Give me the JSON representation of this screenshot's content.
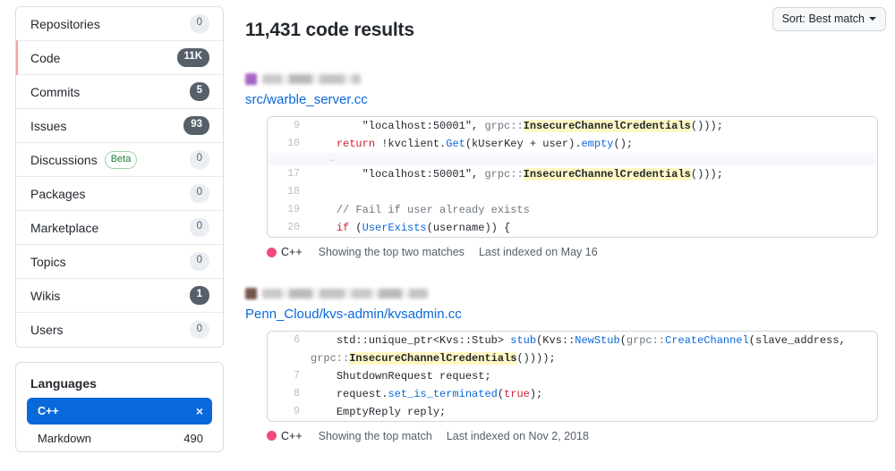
{
  "sidebar": {
    "nav_items": [
      {
        "label": "Repositories",
        "count": "0",
        "zero": true,
        "active": false,
        "badge": null
      },
      {
        "label": "Code",
        "count": "11K",
        "zero": false,
        "active": true,
        "badge": null
      },
      {
        "label": "Commits",
        "count": "5",
        "zero": false,
        "active": false,
        "badge": null
      },
      {
        "label": "Issues",
        "count": "93",
        "zero": false,
        "active": false,
        "badge": null
      },
      {
        "label": "Discussions",
        "count": "0",
        "zero": true,
        "active": false,
        "badge": "Beta"
      },
      {
        "label": "Packages",
        "count": "0",
        "zero": true,
        "active": false,
        "badge": null
      },
      {
        "label": "Marketplace",
        "count": "0",
        "zero": true,
        "active": false,
        "badge": null
      },
      {
        "label": "Topics",
        "count": "0",
        "zero": true,
        "active": false,
        "badge": null
      },
      {
        "label": "Wikis",
        "count": "1",
        "zero": false,
        "active": false,
        "badge": null
      },
      {
        "label": "Users",
        "count": "0",
        "zero": true,
        "active": false,
        "badge": null
      }
    ],
    "languages": {
      "title": "Languages",
      "selected": {
        "name": "C++",
        "remove_icon": "close-icon",
        "remove_glyph": "×"
      },
      "items": [
        {
          "name": "Markdown",
          "count": "490"
        }
      ]
    }
  },
  "header": {
    "title": "11,431 code results",
    "sort": {
      "label": "Sort: Best match",
      "icon": "chevron-down-icon"
    }
  },
  "results": [
    {
      "avatar_color": "purple",
      "repo_blur_width": 110,
      "file_path": "src/warble_server.cc",
      "lines": [
        {
          "num": "9",
          "type": "code",
          "tokens": [
            {
              "t": "        ",
              "c": "t-plain"
            },
            {
              "t": "\"localhost:50001\"",
              "c": "t-str"
            },
            {
              "t": ", ",
              "c": "t-plain"
            },
            {
              "t": "grpc::",
              "c": "t-ns"
            },
            {
              "t": "InsecureChannelCredentials",
              "c": "hl"
            },
            {
              "t": "()));",
              "c": "t-plain"
            }
          ]
        },
        {
          "num": "10",
          "type": "code",
          "tokens": [
            {
              "t": "    ",
              "c": "t-plain"
            },
            {
              "t": "return",
              "c": "t-kw"
            },
            {
              "t": " !kvclient.",
              "c": "t-plain"
            },
            {
              "t": "Get",
              "c": "t-fn"
            },
            {
              "t": "(kUserKey + user).",
              "c": "t-plain"
            },
            {
              "t": "empty",
              "c": "t-fn"
            },
            {
              "t": "();",
              "c": "t-plain"
            }
          ]
        },
        {
          "num": "",
          "type": "sep",
          "dots": "…"
        },
        {
          "num": "17",
          "type": "code",
          "tokens": [
            {
              "t": "        ",
              "c": "t-plain"
            },
            {
              "t": "\"localhost:50001\"",
              "c": "t-str"
            },
            {
              "t": ", ",
              "c": "t-plain"
            },
            {
              "t": "grpc::",
              "c": "t-ns"
            },
            {
              "t": "InsecureChannelCredentials",
              "c": "hl"
            },
            {
              "t": "()));",
              "c": "t-plain"
            }
          ]
        },
        {
          "num": "18",
          "type": "code",
          "tokens": [
            {
              "t": "",
              "c": "t-plain"
            }
          ]
        },
        {
          "num": "19",
          "type": "code",
          "tokens": [
            {
              "t": "    ",
              "c": "t-plain"
            },
            {
              "t": "// Fail if user already exists",
              "c": "t-cmt"
            }
          ]
        },
        {
          "num": "20",
          "type": "code",
          "tokens": [
            {
              "t": "    ",
              "c": "t-plain"
            },
            {
              "t": "if",
              "c": "t-kw"
            },
            {
              "t": " (",
              "c": "t-plain"
            },
            {
              "t": "UserExists",
              "c": "t-fn"
            },
            {
              "t": "(username)) {",
              "c": "t-plain"
            }
          ]
        }
      ],
      "meta": {
        "language": "C++",
        "language_color": "#f34b7d",
        "matches": "Showing the top two matches",
        "indexed": "Last indexed on May 16"
      }
    },
    {
      "avatar_color": "brown",
      "repo_blur_width": 185,
      "file_path": "Penn_Cloud/kvs-admin/kvsadmin.cc",
      "lines": [
        {
          "num": "6",
          "type": "code",
          "tokens": [
            {
              "t": "    std::unique_ptr<Kvs::Stub> ",
              "c": "t-plain"
            },
            {
              "t": "stub",
              "c": "t-fn"
            },
            {
              "t": "(Kvs::",
              "c": "t-plain"
            },
            {
              "t": "NewStub",
              "c": "t-fn"
            },
            {
              "t": "(",
              "c": "t-plain"
            },
            {
              "t": "grpc::",
              "c": "t-ns"
            },
            {
              "t": "CreateChannel",
              "c": "t-fn"
            },
            {
              "t": "(slave_address, ",
              "c": "t-plain"
            },
            {
              "t": "grpc::",
              "c": "t-ns"
            },
            {
              "t": "InsecureChannelCredentials",
              "c": "hl"
            },
            {
              "t": "())));",
              "c": "t-plain"
            }
          ]
        },
        {
          "num": "7",
          "type": "code",
          "tokens": [
            {
              "t": "    ShutdownRequest request;",
              "c": "t-plain"
            }
          ]
        },
        {
          "num": "8",
          "type": "code",
          "tokens": [
            {
              "t": "    request.",
              "c": "t-plain"
            },
            {
              "t": "set_is_terminated",
              "c": "t-fn"
            },
            {
              "t": "(",
              "c": "t-plain"
            },
            {
              "t": "true",
              "c": "t-kw"
            },
            {
              "t": ");",
              "c": "t-plain"
            }
          ]
        },
        {
          "num": "9",
          "type": "code",
          "tokens": [
            {
              "t": "    EmptyReply reply;",
              "c": "t-plain"
            }
          ]
        }
      ],
      "meta": {
        "language": "C++",
        "language_color": "#f34b7d",
        "matches": "Showing the top match",
        "indexed": "Last indexed on Nov 2, 2018"
      }
    }
  ]
}
